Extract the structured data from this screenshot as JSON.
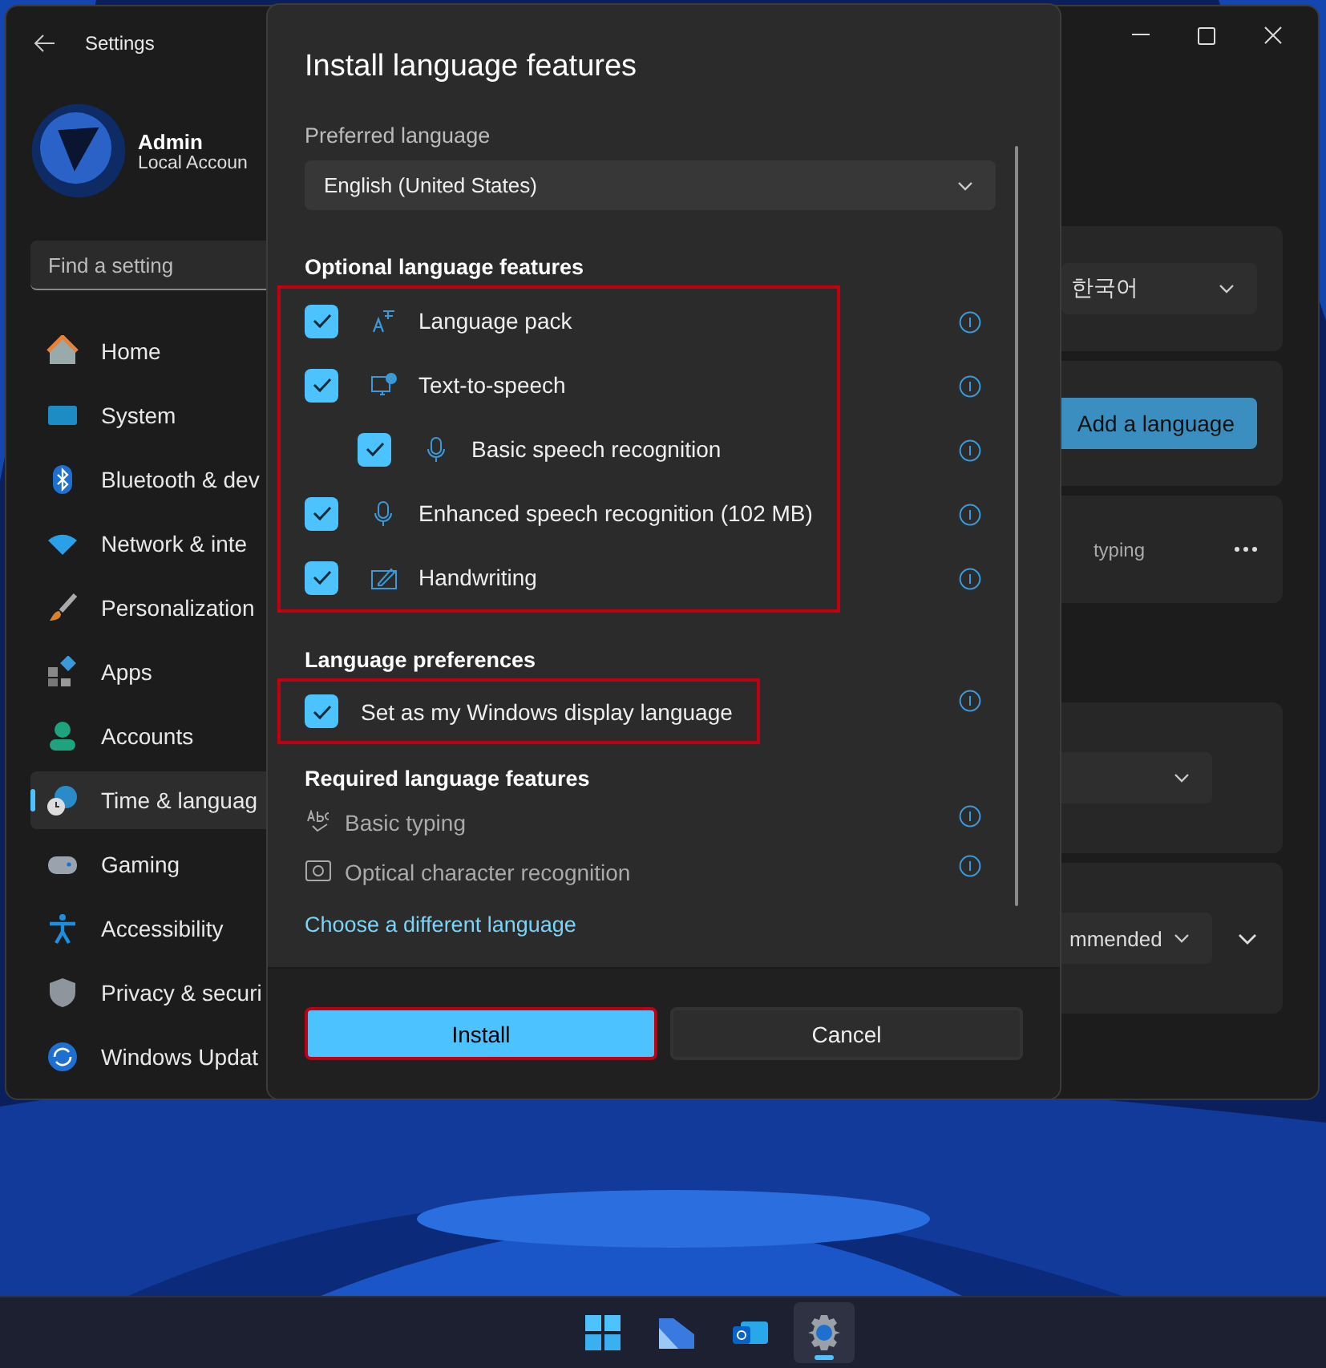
{
  "settings_window": {
    "title": "Settings",
    "user": {
      "name": "Admin",
      "account": "Local Accoun"
    },
    "search": {
      "placeholder": "Find a setting"
    },
    "nav": [
      {
        "label": "Home",
        "selected": false
      },
      {
        "label": "System",
        "selected": false
      },
      {
        "label": "Bluetooth & dev",
        "selected": false
      },
      {
        "label": "Network & inte",
        "selected": false
      },
      {
        "label": "Personalization",
        "selected": false
      },
      {
        "label": "Apps",
        "selected": false
      },
      {
        "label": "Accounts",
        "selected": false
      },
      {
        "label": "Time & languag",
        "selected": true
      },
      {
        "label": "Gaming",
        "selected": false
      },
      {
        "label": "Accessibility",
        "selected": false
      },
      {
        "label": "Privacy & securi",
        "selected": false
      },
      {
        "label": "Windows Updat",
        "selected": false
      }
    ],
    "display_language": {
      "value": "한국어"
    },
    "add_language_button": "Add a language",
    "language_row": {
      "detail": "typing"
    },
    "regional_format": {
      "value": "mmended"
    }
  },
  "dialog": {
    "title": "Install language features",
    "preferred_label": "Preferred language",
    "preferred_value": "English (United States)",
    "optional_heading": "Optional language features",
    "optional_highlighted": true,
    "optional_features": [
      {
        "label": "Language pack",
        "checked": true
      },
      {
        "label": "Text-to-speech",
        "checked": true,
        "children": [
          {
            "label": "Basic speech recognition",
            "checked": true
          }
        ]
      },
      {
        "label": "Enhanced speech recognition (102 MB)",
        "checked": true
      },
      {
        "label": "Handwriting",
        "checked": true
      }
    ],
    "preferences_heading": "Language preferences",
    "display_option": {
      "label": "Set as my Windows display language",
      "checked": true,
      "highlighted": true
    },
    "required_heading": "Required language features",
    "required_features": [
      {
        "label": "Basic typing"
      },
      {
        "label": "Optical character recognition"
      }
    ],
    "link": "Choose a different language",
    "install_button": {
      "label": "Install",
      "highlighted": true
    },
    "cancel_button": "Cancel"
  },
  "taskbar": {
    "items": [
      {
        "selected": false
      },
      {
        "selected": false
      },
      {
        "selected": false
      },
      {
        "selected": true
      }
    ]
  }
}
